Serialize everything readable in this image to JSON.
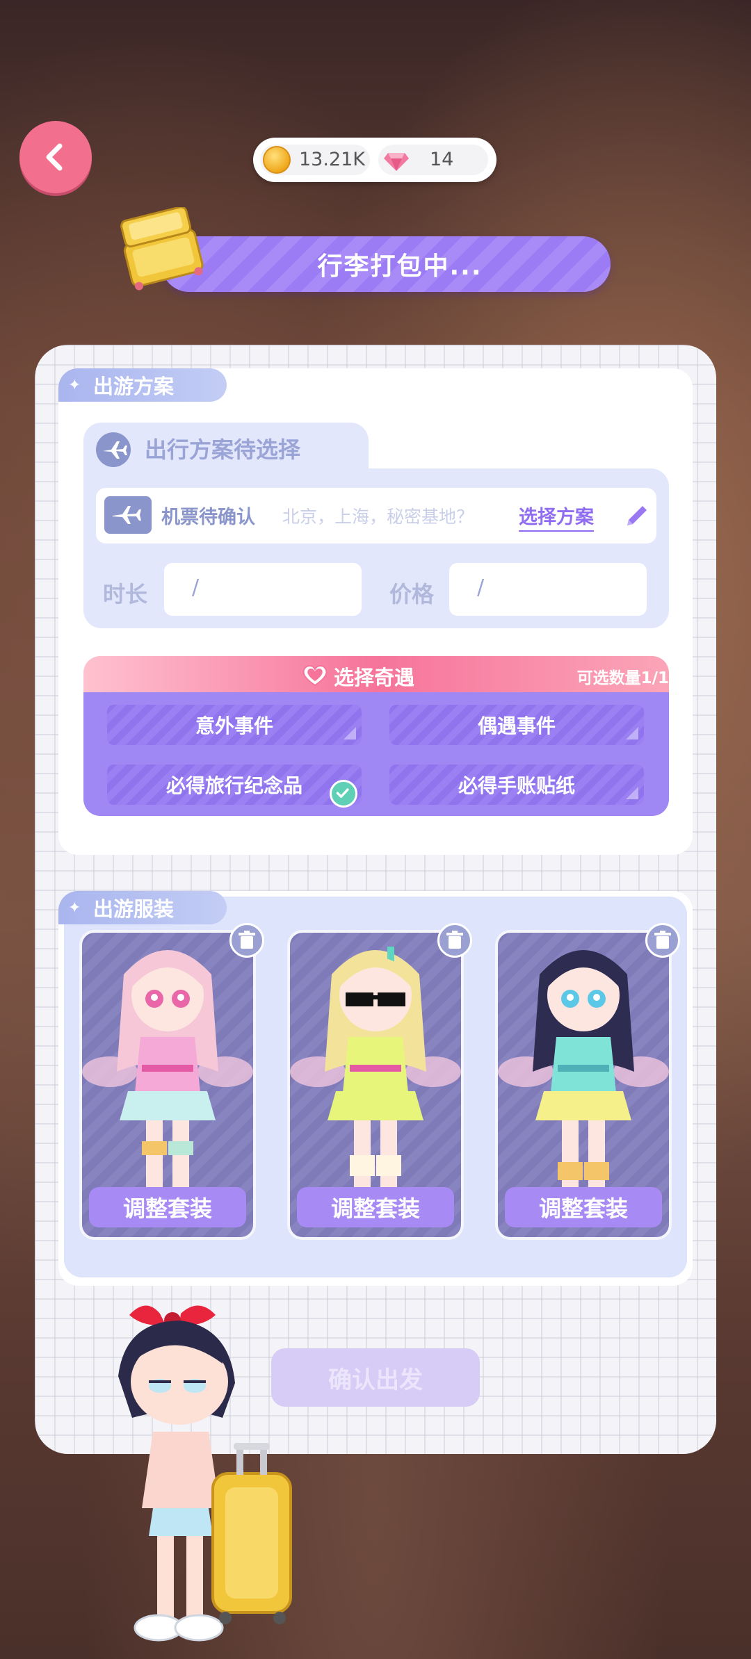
{
  "header": {
    "back_icon": "chevron-left-icon",
    "coins": "13.21K",
    "gems": "14",
    "banner_title": "行李打包中..."
  },
  "plan_section": {
    "tag": "出游方案",
    "tab_title": "出行方案待选择",
    "ticket_label": "机票待确认",
    "ticket_hint": "北京，上海，秘密基地？",
    "choose_link": "选择方案",
    "duration_label": "时长",
    "duration_value": "/",
    "price_label": "价格",
    "price_value": "/"
  },
  "encounter": {
    "title": "选择奇遇",
    "count": "可选数量1/1",
    "options": [
      {
        "label": "意外事件",
        "selected": false
      },
      {
        "label": "偶遇事件",
        "selected": false
      },
      {
        "label": "必得旅行纪念品",
        "selected": true
      },
      {
        "label": "必得手账贴纸",
        "selected": false
      }
    ]
  },
  "outfit_section": {
    "tag": "出游服装",
    "cards": [
      {
        "button": "调整套装",
        "hair": "#f6c7d6",
        "dress": "#f4a9d6",
        "skirt": "#c9f0ee"
      },
      {
        "button": "调整套装",
        "hair": "#f3e39a",
        "dress": "#e7f57a",
        "skirt": "#e7f57a"
      },
      {
        "button": "调整套装",
        "hair": "#2f2c52",
        "dress": "#7fe3d8",
        "skirt": "#f5f08a"
      }
    ]
  },
  "confirm_button": "确认出发",
  "colors": {
    "accent_purple": "#9b7cf5",
    "pink": "#f2708e",
    "check_green": "#5fd0b6"
  }
}
